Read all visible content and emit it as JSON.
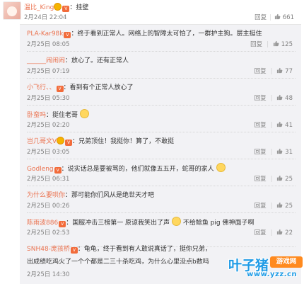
{
  "top_post": {
    "username": "温比_King",
    "colon_text": "：挂壁",
    "time": "2月24日 22:04",
    "reply_label": "回复",
    "like_count": "661"
  },
  "replies": [
    {
      "username": "PLA-Kar98k",
      "text": "：终于看到正常人。网络上的智障太可怕了，一群护主狗。层主挺住",
      "time": "2月25日 08:05",
      "reply_label": "回复",
      "likes": "125"
    },
    {
      "username": "______闹闹闹",
      "text": "：放心了。还有正常人",
      "time": "2月25日 07:19",
      "reply_label": "回复",
      "likes": "77"
    },
    {
      "username": "小飞行、、",
      "text": "：看到有个正常人放心了",
      "time": "2月25日 05:30",
      "reply_label": "回复",
      "likes": "48"
    },
    {
      "username": "卧蛮吗",
      "text": "：挺住老哥",
      "time": "2月25日 02:20",
      "reply_label": "回复",
      "likes": "41"
    },
    {
      "username": "岂几哥文V",
      "text": "：兄弟顶住！我挺你！算了，不敢挺",
      "time": "2月25日 03:05",
      "reply_label": "回复",
      "likes": "31"
    },
    {
      "username": "Godleng",
      "text": "：说实话总是要被骂的，他们就像五五开，蛇哥的家人",
      "time": "2月25日 06:31",
      "reply_label": "回复",
      "likes": "25"
    },
    {
      "username": "为什么要哄你",
      "text": "：那可能你们风从是绝世天才吧",
      "time": "2月25日 00:26",
      "reply_label": "回复",
      "likes": "25"
    },
    {
      "username": "陈雨波886",
      "text": "：国服冲击三榜第一 原谅我笑出了声",
      "text2": "不给鲶鱼 pig 佛神面子啊",
      "time": "2月25日 02:53",
      "reply_label": "回复",
      "likes": "22"
    },
    {
      "username": "SNH48-庞孩桥",
      "text": "：龟龟，终于看到有人敢说真话了，挺你兄弟，",
      "text2": "出成绩吃鸡火了一个个都是二三十杀吃鸡，为什么心里没点b数吗",
      "time": "2月25日 14:30",
      "reply_label": "回复",
      "likes": ""
    }
  ],
  "watermark": {
    "brand": "叶子猪",
    "badge": "游戏网",
    "url": "www.yzz.cn"
  },
  "colors": {
    "username": "#eb7350",
    "reply_bg": "#f2f2f5",
    "watermark_blue": "#1e9be6",
    "watermark_orange": "#ff8a1e"
  }
}
